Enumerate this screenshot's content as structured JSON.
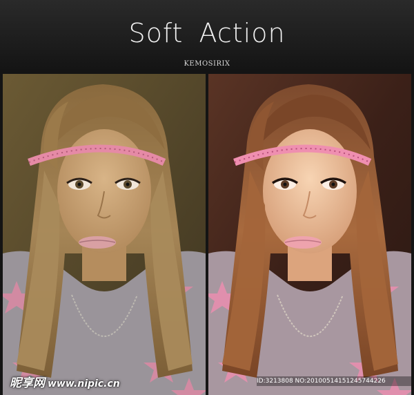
{
  "header": {
    "title": "Soft Action",
    "subtitle": "KEMOSIRIX"
  },
  "photos": [
    {
      "label": "",
      "style": "original"
    },
    {
      "label": "",
      "style": "soft-action-edited"
    }
  ],
  "watermarks": {
    "logo_text": "昵享网",
    "url_text": "www.nipic.cn",
    "id_text": "ID:3213808 NO:20100514151245744226"
  },
  "colors": {
    "background": "#151515",
    "title": "#f1f1f1",
    "headband": "#e58aa6",
    "shirt_star": "#d98aa3"
  }
}
